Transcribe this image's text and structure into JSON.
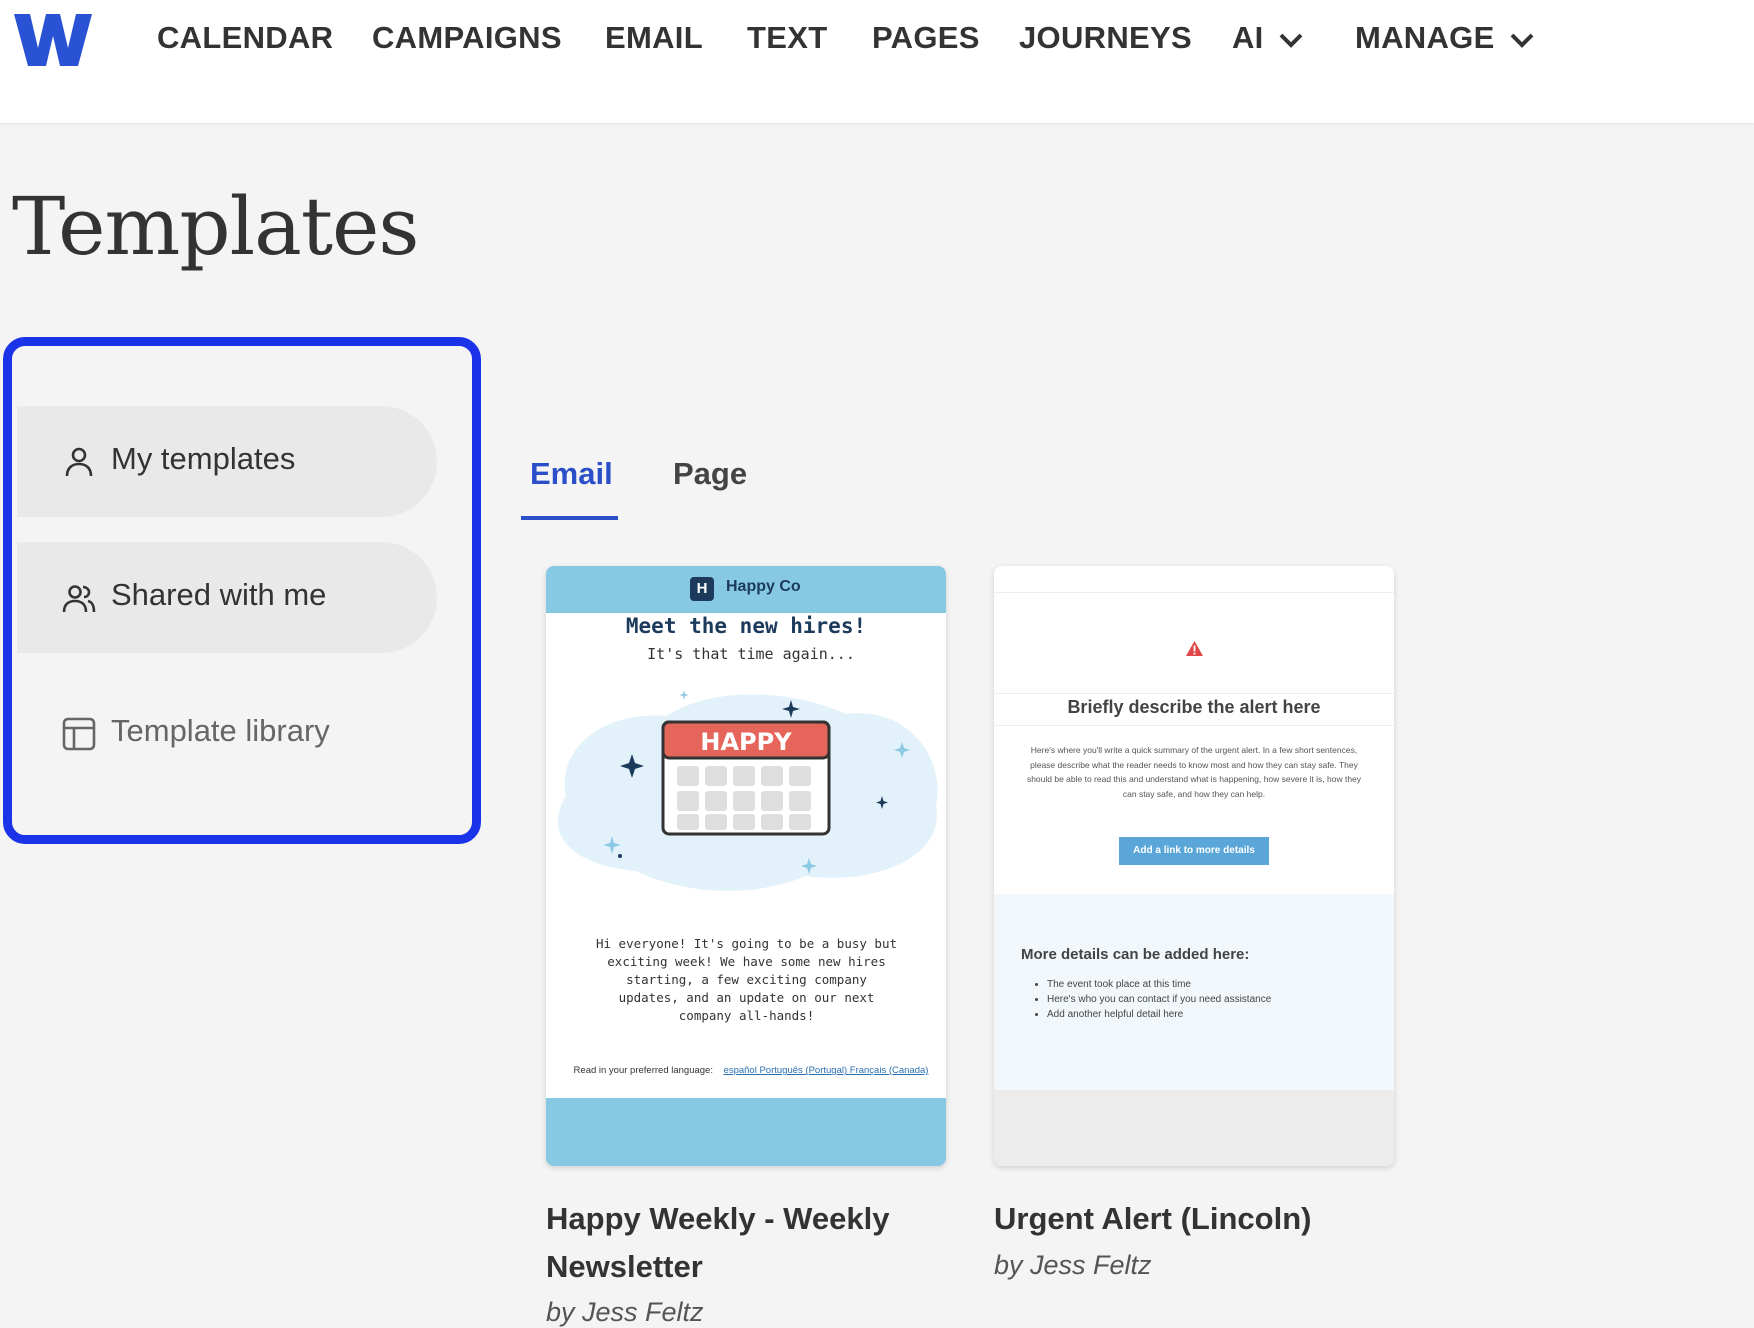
{
  "nav": {
    "items": [
      {
        "label": "CALENDAR"
      },
      {
        "label": "CAMPAIGNS"
      },
      {
        "label": "EMAIL"
      },
      {
        "label": "TEXT"
      },
      {
        "label": "PAGES"
      },
      {
        "label": "JOURNEYS"
      },
      {
        "label": "AI",
        "has_dropdown": true
      },
      {
        "label": "MANAGE",
        "has_dropdown": true
      }
    ],
    "logo_icon": "w-logo-icon"
  },
  "page": {
    "title": "Templates"
  },
  "sidebar": {
    "items": [
      {
        "label": "My templates",
        "icon": "user-icon"
      },
      {
        "label": "Shared with me",
        "icon": "users-icon"
      },
      {
        "label": "Template library",
        "icon": "layout-icon"
      }
    ],
    "highlight_color": "#1a33e8"
  },
  "tabs": [
    {
      "label": "Email",
      "active": true
    },
    {
      "label": "Page",
      "active": false
    }
  ],
  "accent_color": "#2a4fc9",
  "templates": [
    {
      "title": "Happy Weekly - Weekly Newsletter",
      "author": "by Jess Feltz",
      "preview": {
        "brand": "Happy Co",
        "intro": "It's that time again...",
        "banner_text": "HAPPY",
        "body": "Hi everyone! It's going to be a busy but exciting week! We have some new hires starting, a few exciting company updates, and an update on our next company all-hands!",
        "lang_label": "Read in your preferred language:",
        "lang_links": "español Português (Portugal) Français (Canada)",
        "footer_heading": "Meet the new hires!"
      }
    },
    {
      "title": "Urgent Alert (Lincoln)",
      "author": "by Jess Feltz",
      "preview": {
        "headline": "Briefly describe the alert here",
        "summary": "Here's where you'll write a quick summary of the urgent alert. In a few short sentences, please describe what the reader needs to know most and how they can stay safe. They should be able to read this and understand what is happening, how severe it is, how they can stay safe, and how they can help.",
        "button": "Add a link to more details",
        "details_heading": "More details can be added here:",
        "details": [
          "The event took place at this time",
          "Here's who you can contact if you need assistance",
          "Add another helpful detail here"
        ]
      }
    }
  ]
}
